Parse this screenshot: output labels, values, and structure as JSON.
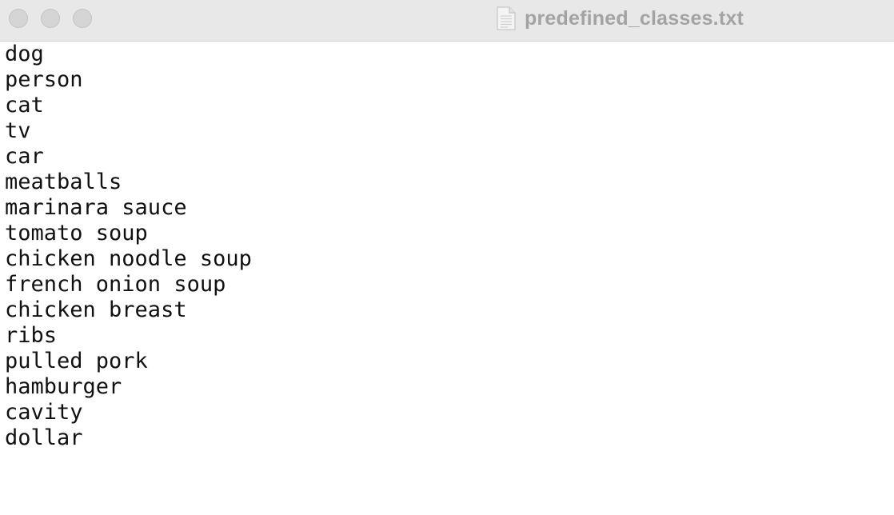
{
  "window": {
    "title": "predefined_classes.txt",
    "file_icon": "text-document-icon"
  },
  "document": {
    "lines": [
      "dog",
      "person",
      "cat",
      "tv",
      "car",
      "meatballs",
      "marinara sauce",
      "tomato soup",
      "chicken noodle soup",
      "french onion soup",
      "chicken breast",
      "ribs",
      "pulled pork",
      "hamburger",
      "cavity",
      "dollar"
    ]
  }
}
